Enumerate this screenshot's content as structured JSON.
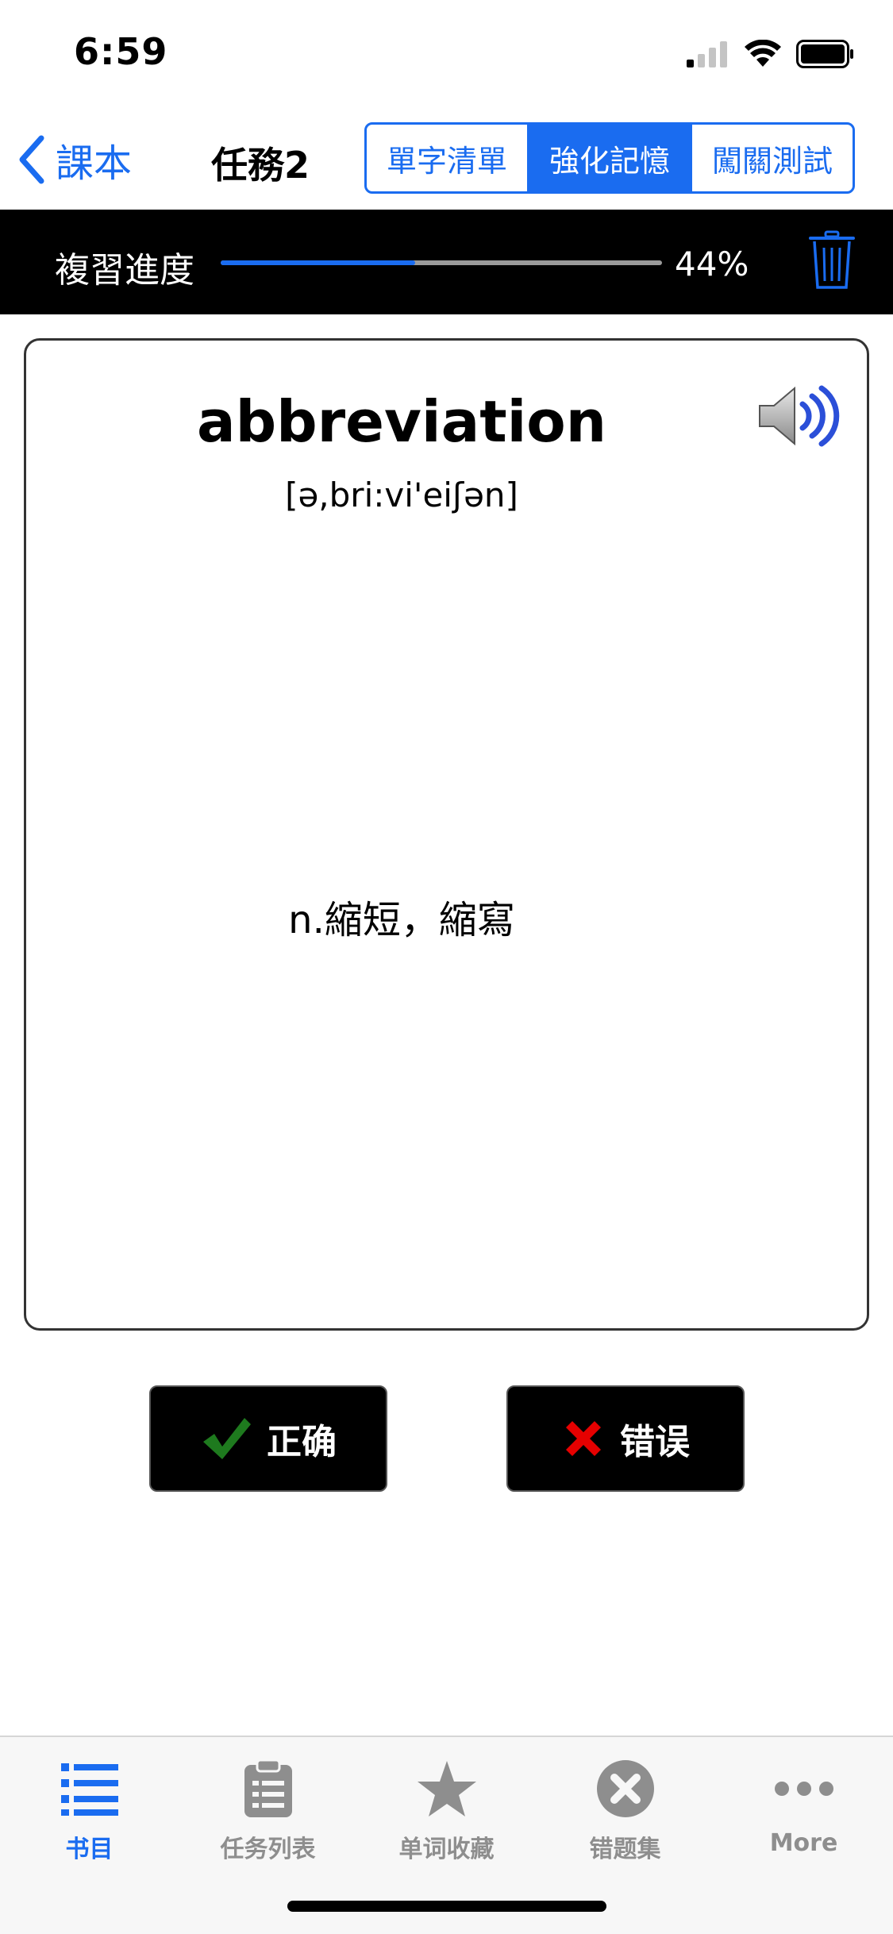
{
  "status_bar": {
    "time": "6:59"
  },
  "nav": {
    "back_label": "課本",
    "title": "任務2",
    "segments": [
      {
        "label": "單字清單",
        "active": false
      },
      {
        "label": "強化記憶",
        "active": true
      },
      {
        "label": "闖關測試",
        "active": false
      }
    ]
  },
  "review": {
    "label": "複習進度",
    "percent_text": "44%",
    "progress_fraction": 0.44
  },
  "card": {
    "word": "abbreviation",
    "phonetic": "[ə,bri:vi'eiʃən]",
    "meaning": "n.縮短，縮寫"
  },
  "actions": {
    "correct_label": "正确",
    "wrong_label": "错误"
  },
  "tabs": [
    {
      "label": "书目",
      "icon": "list-icon",
      "active": true
    },
    {
      "label": "任务列表",
      "icon": "clipboard-icon",
      "active": false
    },
    {
      "label": "单词收藏",
      "icon": "star-icon",
      "active": false
    },
    {
      "label": "错题集",
      "icon": "x-circle-icon",
      "active": false
    },
    {
      "label": "More",
      "icon": "more-icon",
      "active": false
    }
  ],
  "colors": {
    "accent": "#1a6cf0",
    "progress_track": "#9a9a9a",
    "correct_check": "#1e7a1e",
    "wrong_x": "#e60000"
  }
}
